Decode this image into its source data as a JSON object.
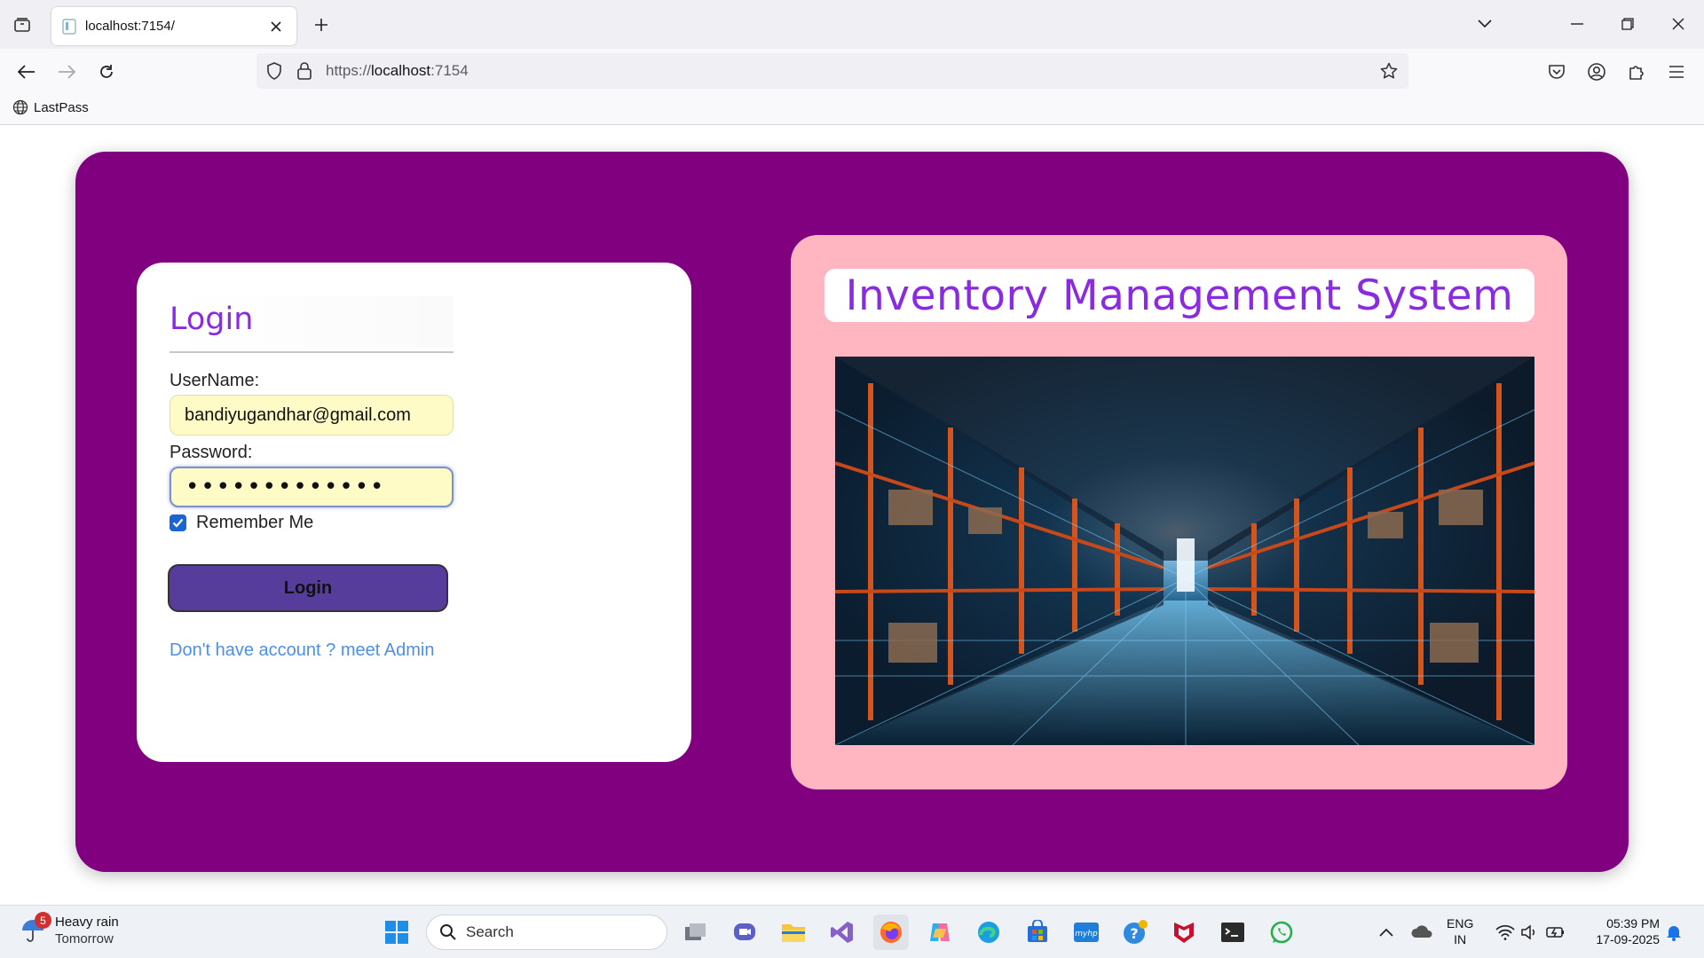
{
  "browser": {
    "tab_title": "localhost:7154/",
    "url_prefix": "https://",
    "url_host": "localhost",
    "url_suffix": ":7154",
    "bookmarks": [
      {
        "label": "LastPass",
        "icon": "globe-icon"
      }
    ]
  },
  "login": {
    "title": "Login",
    "username_label": "UserName:",
    "username_value": "bandiyugandhar@gmail.com",
    "password_label": "Password:",
    "password_masked": "•••••••••••••",
    "remember_label": "Remember Me",
    "remember_checked": true,
    "button_label": "Login",
    "admin_link": "Don't have account ? meet Admin"
  },
  "info": {
    "title": "Inventory Management System",
    "image": "warehouse-photo"
  },
  "colors": {
    "frame": "#800080",
    "info_card": "#ffb6c1",
    "title": "#8a2be2",
    "button": "#563d9b",
    "link": "#4d8fe8"
  },
  "taskbar": {
    "weather_badge": "5",
    "weather_title": "Heavy rain",
    "weather_sub": "Tomorrow",
    "search_label": "Search",
    "lang_line1": "ENG",
    "lang_line2": "IN",
    "time": "05:39 PM",
    "date": "17-09-2025"
  }
}
